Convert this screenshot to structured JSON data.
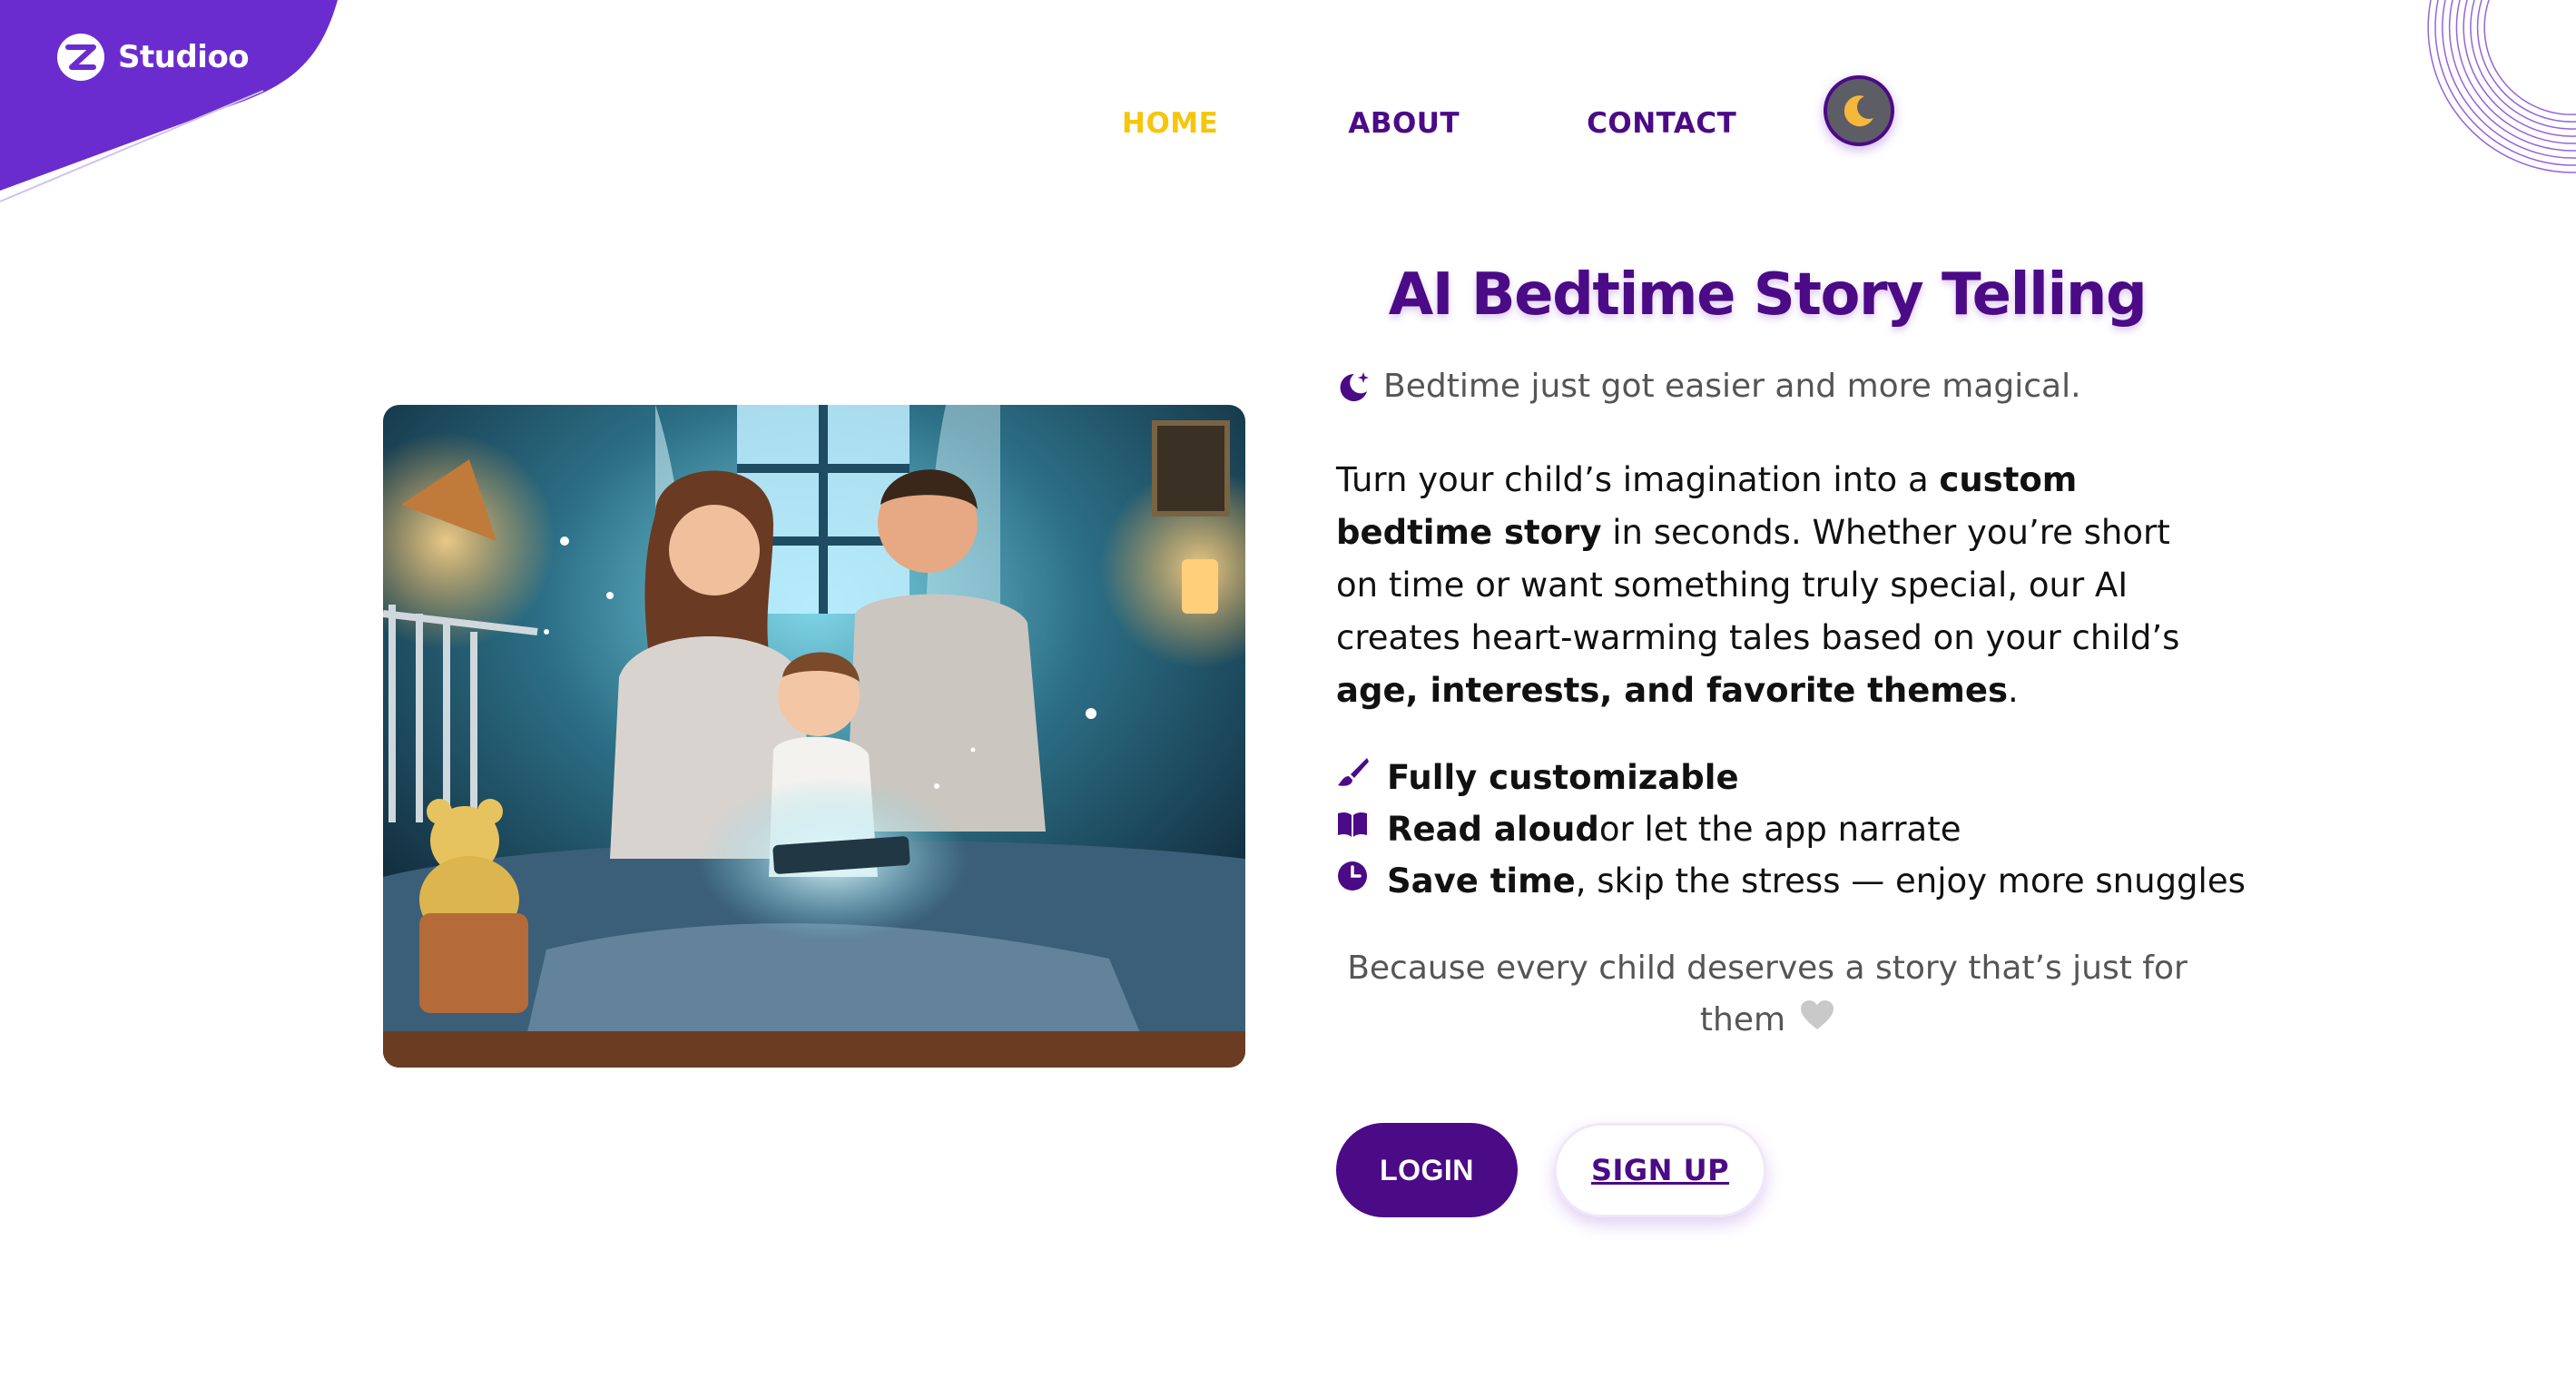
{
  "brand": {
    "name": "Studioo",
    "accent_color": "#4b0a86",
    "corner_color": "#6a2ccf",
    "highlight_color": "#f5c60b"
  },
  "nav": {
    "items": [
      "HOME",
      "ABOUT",
      "CONTACT"
    ],
    "active": "HOME",
    "theme_toggle_icon": "moon-icon"
  },
  "hero": {
    "image_alt": "family reading a bedtime story on a tablet",
    "title": "AI Bedtime Story Telling",
    "tagline": "Bedtime just got easier and more magical.",
    "intro": {
      "p1": "Turn your child’s imagination into a ",
      "b1": "custom bedtime story",
      "p2": " in seconds. Whether you’re short on time or want something truly special, our AI creates heart-warming tales based on your child’s ",
      "b2": "age, interests, and favorite themes",
      "p3": "."
    },
    "features": [
      {
        "icon": "paintbrush-icon",
        "bold": "Fully customizable",
        "rest": ""
      },
      {
        "icon": "book-icon",
        "bold": "Read aloud",
        "rest": " or let the app narrate"
      },
      {
        "icon": "clock-icon",
        "bold": "Save time",
        "rest": ", skip the stress — enjoy more snuggles"
      }
    ],
    "closing": "Because every child deserves a story that’s just for them",
    "closing_icon": "heart-icon"
  },
  "actions": {
    "login": "LOGIN",
    "signup": "SIGN UP"
  }
}
